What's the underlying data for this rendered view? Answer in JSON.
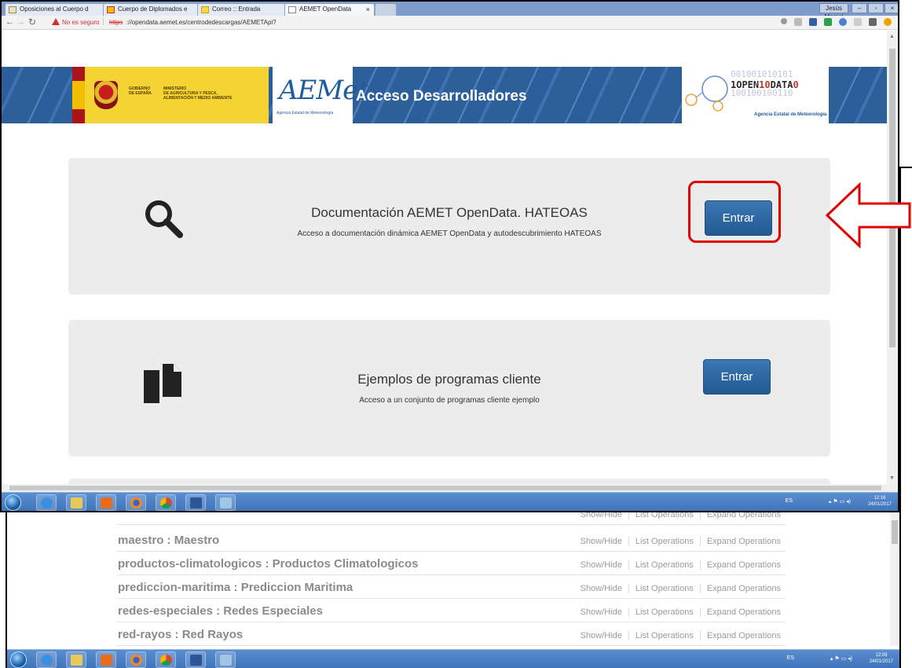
{
  "browser": {
    "tabs": [
      {
        "label": "Oposiciones al Cuerpo d"
      },
      {
        "label": "Cuerpo de Diplomados e"
      },
      {
        "label": "Correo :: Entrada"
      },
      {
        "label": "AEMET OpenData"
      }
    ],
    "tab_close": "×",
    "window_controls": {
      "user": "Jesús Marcel",
      "minimize": "–",
      "maximize": "▫",
      "close": "×"
    },
    "security_warning": "No es seguro",
    "url_scheme": "https",
    "url_rest": "://opendata.aemet.es/centrodedescargas/AEMETApi?"
  },
  "banner": {
    "gov_text": [
      "GOBIERNO",
      "DE ESPAÑA"
    ],
    "ministry_text": [
      "MINISTERIO",
      "DE AGRICULTURA Y PESCA,",
      "ALIMENTACIÓN Y MEDIO AMBIENTE"
    ],
    "aemet_logo": "AEMet",
    "aemet_subtitle": "Agencia Estatal de Meteorología",
    "title": "Acceso Desarrolladores",
    "opendata_bits_top": "001001010101",
    "opendata_mid": [
      "1",
      "OPEN",
      "10",
      "DATA",
      "0"
    ],
    "opendata_bits_bottom": "100100100110",
    "opendata_agency": "Agencia Estatal de Meteorología"
  },
  "cards": [
    {
      "icon": "search-icon",
      "title": "Documentación AEMET OpenData. HATEOAS",
      "description": "Acceso a documentación dinámica AEMET OpenData y autodescubrimiento HATEOAS",
      "button": "Entrar"
    },
    {
      "icon": "documents-icon",
      "title": "Ejemplos de programas cliente",
      "description": "Acceso a un conjunto de programas cliente ejemplo",
      "button": "Entrar"
    }
  ],
  "taskbar1": {
    "tray": "ES",
    "clock_time": "12:16",
    "clock_date": "24/01/2017"
  },
  "api_list": [
    {
      "name": "maestro : Maestro"
    },
    {
      "name": "productos-climatologicos : Productos Climatologicos"
    },
    {
      "name": "prediccion-maritima : Prediccion Maritima"
    },
    {
      "name": "redes-especiales : Redes Especiales"
    },
    {
      "name": "red-rayos : Red Rayos"
    }
  ],
  "api_links": {
    "show_hide": "Show/Hide",
    "list": "List Operations",
    "expand": "Expand Operations"
  },
  "taskbar2": {
    "tray": "ES",
    "clock_time": "12:09",
    "clock_date": "24/01/2017"
  },
  "colors": {
    "annotation": "#e00000",
    "button": "#2f6aa6",
    "banner": "#2c5e9b"
  }
}
